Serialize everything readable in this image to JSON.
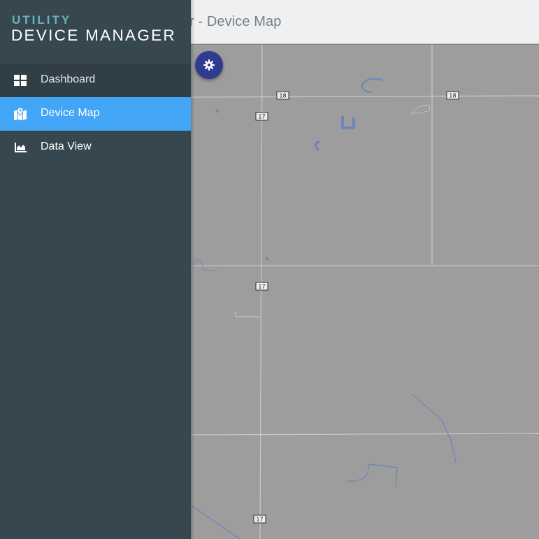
{
  "header": {
    "title": "r - Device Map"
  },
  "brand": {
    "line1": "UTILITY",
    "line2": "DEVICE MANAGER"
  },
  "nav": {
    "items": [
      {
        "label": "Dashboard",
        "icon": "dashboard-grid-icon",
        "active": false
      },
      {
        "label": "Device Map",
        "icon": "map-marker-icon",
        "active": true
      },
      {
        "label": "Data View",
        "icon": "area-chart-icon",
        "active": false
      }
    ]
  },
  "map": {
    "road_shields": [
      "18",
      "18",
      "17",
      "17",
      "17"
    ]
  },
  "settings_button": {
    "icon": "gear-icon"
  },
  "colors": {
    "drawer_bg": "#37474f",
    "active_item": "#42a5f5",
    "brand_accent": "#6fb3b8",
    "map_bg": "#9d9d9d",
    "water": "#6f86b8",
    "fab": "#2f3b8f"
  }
}
